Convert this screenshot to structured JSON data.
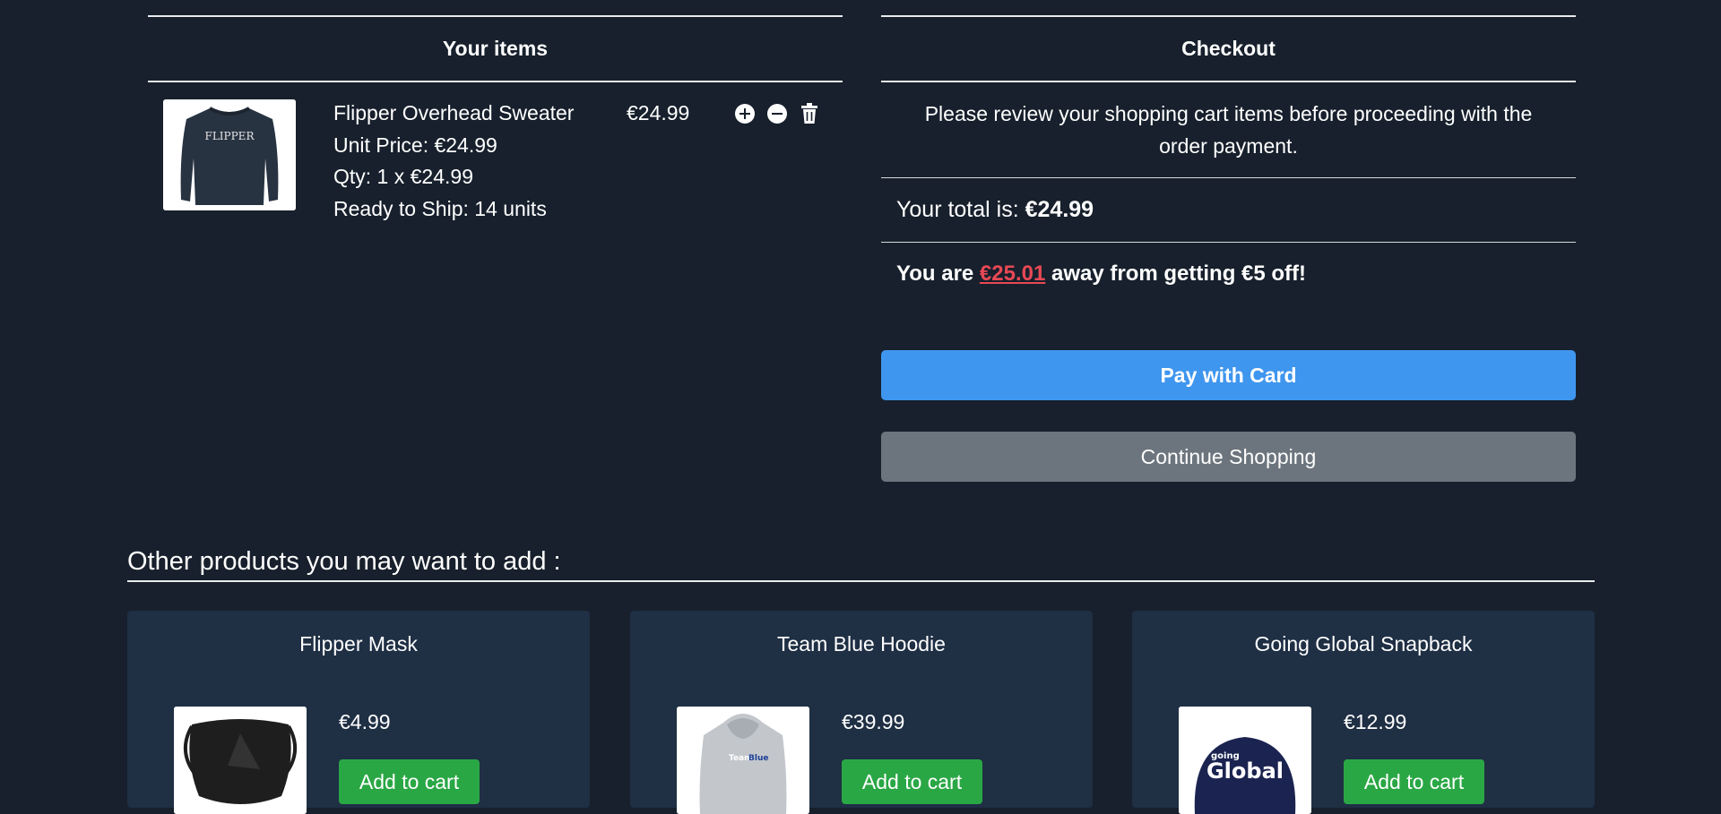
{
  "cart": {
    "heading": "Your items",
    "items": [
      {
        "name": "Flipper Overhead Sweater",
        "unit_price": "Unit Price: €24.99",
        "qty": "Qty: 1 x €24.99",
        "ready": "Ready to Ship: 14 units",
        "price": "€24.99",
        "image_text": "FLIPPER"
      }
    ]
  },
  "checkout": {
    "heading": "Checkout",
    "message": "Please review your shopping cart items before proceeding with the order payment.",
    "total_label": "Your total is: ",
    "total_value": "€24.99",
    "away_prefix": "You are ",
    "away_amount": "€25.01",
    "away_suffix": " away from getting €5 off!",
    "pay_button": "Pay with Card",
    "continue_button": "Continue Shopping"
  },
  "other": {
    "title": "Other products you may want to add :",
    "products": [
      {
        "name": "Flipper Mask",
        "price": "€4.99",
        "add_label": "Add to cart"
      },
      {
        "name": "Team Blue Hoodie",
        "price": "€39.99",
        "add_label": "Add to cart",
        "image_text_a": "Team",
        "image_text_b": "Blue"
      },
      {
        "name": "Going Global Snapback",
        "price": "€12.99",
        "add_label": "Add to cart",
        "image_text_a": "going",
        "image_text_b": "Global"
      }
    ]
  },
  "colors": {
    "background": "#17202c",
    "card": "#1f2f44",
    "pay": "#3f96ee",
    "continue": "#6c757d",
    "add": "#2aa745",
    "discount": "#e84855"
  }
}
